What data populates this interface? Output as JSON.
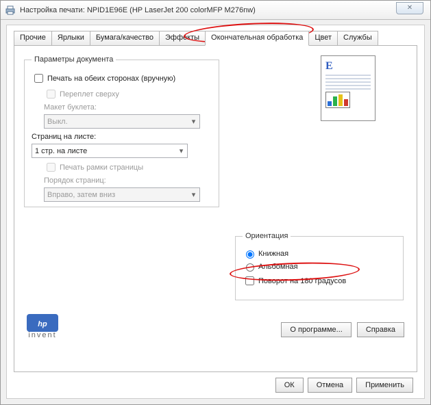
{
  "window": {
    "title": "Настройка печати: NPID1E96E (HP LaserJet 200 colorMFP M276nw)",
    "close": "✕"
  },
  "tabs": [
    "Прочие",
    "Ярлыки",
    "Бумага/качество",
    "Эффекты",
    "Окончательная обработка",
    "Цвет",
    "Службы"
  ],
  "doc": {
    "legend": "Параметры документа",
    "duplex": "Печать на обеих сторонах (вручную)",
    "flip": "Переплет сверху",
    "booklet_label": "Макет буклета:",
    "booklet_value": "Выкл.",
    "pps_label": "Страниц на листе:",
    "pps_value": "1 стр. на листе",
    "borders": "Печать рамки страницы",
    "order_label": "Порядок страниц:",
    "order_value": "Вправо, затем вниз"
  },
  "orient": {
    "legend": "Ориентация",
    "portrait": "Книжная",
    "landscape": "Альбомная",
    "rotate": "Поворот на 180 градусов"
  },
  "buttons": {
    "about": "О программе...",
    "help": "Справка",
    "ok": "ОК",
    "cancel": "Отмена",
    "apply": "Применить"
  },
  "hp": {
    "brand": "hp",
    "sub": "invent"
  },
  "preview": {
    "letter": "E"
  }
}
